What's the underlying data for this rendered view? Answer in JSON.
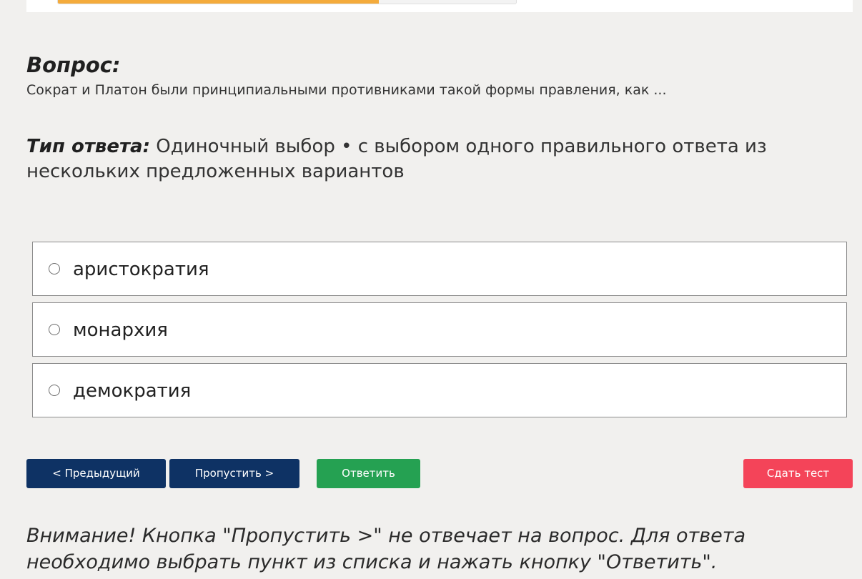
{
  "progress": {
    "fraction": 0.7
  },
  "question": {
    "heading": "Вопрос:",
    "text": "Сократ и Платон были принципиальными противниками такой формы правления, как ..."
  },
  "answer_type": {
    "label": "Тип ответа:",
    "value": "Одиночный выбор • с выбором одного правильного ответа из нескольких предложенных вариантов"
  },
  "options": [
    {
      "label": "аристократия",
      "selected": false
    },
    {
      "label": "монархия",
      "selected": false
    },
    {
      "label": "демократия",
      "selected": false
    }
  ],
  "buttons": {
    "prev_label": "< Предыдущий",
    "skip_label": "Пропустить >",
    "answer_label": "Ответить",
    "submit_label": "Сдать тест"
  },
  "colors": {
    "progress": "#f4ab3c",
    "nav_button": "#0e3264",
    "answer_button": "#25a152",
    "submit_button": "#f44459"
  },
  "warning": "Внимание! Кнопка \"Пропустить >\" не отвечает на вопрос. Для ответа необходимо выбрать пункт из списка и нажать кнопку \"Ответить\"."
}
